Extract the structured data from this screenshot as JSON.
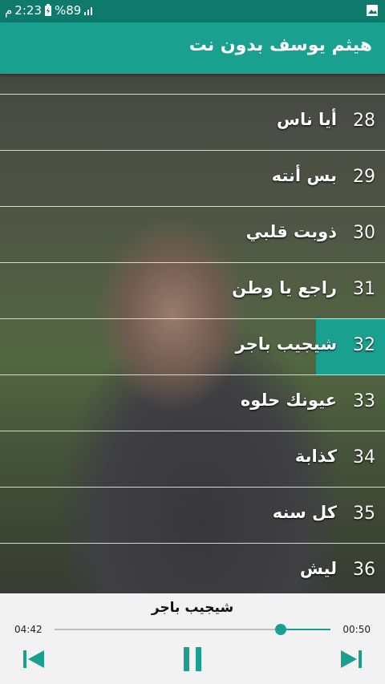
{
  "status": {
    "time": "2:23",
    "am_pm": "م",
    "battery": "%89"
  },
  "app": {
    "title": "هيثم يوسف بدون نت",
    "accent": "#19a08e"
  },
  "list": {
    "active_number": "32",
    "items": [
      {
        "num": "28",
        "title": "أيا ناس"
      },
      {
        "num": "29",
        "title": "بس أنته"
      },
      {
        "num": "30",
        "title": "ذوبت قلبي"
      },
      {
        "num": "31",
        "title": "راجع يا وطن"
      },
      {
        "num": "32",
        "title": "شيجيب باجر"
      },
      {
        "num": "33",
        "title": "عيونك حلوه"
      },
      {
        "num": "34",
        "title": "كذابة"
      },
      {
        "num": "35",
        "title": "كل سنه"
      },
      {
        "num": "36",
        "title": "ليش"
      }
    ]
  },
  "player": {
    "now_playing": "شيجيب باجر",
    "total_time": "04:42",
    "elapsed_time": "00:50",
    "progress_fraction": 0.18
  }
}
